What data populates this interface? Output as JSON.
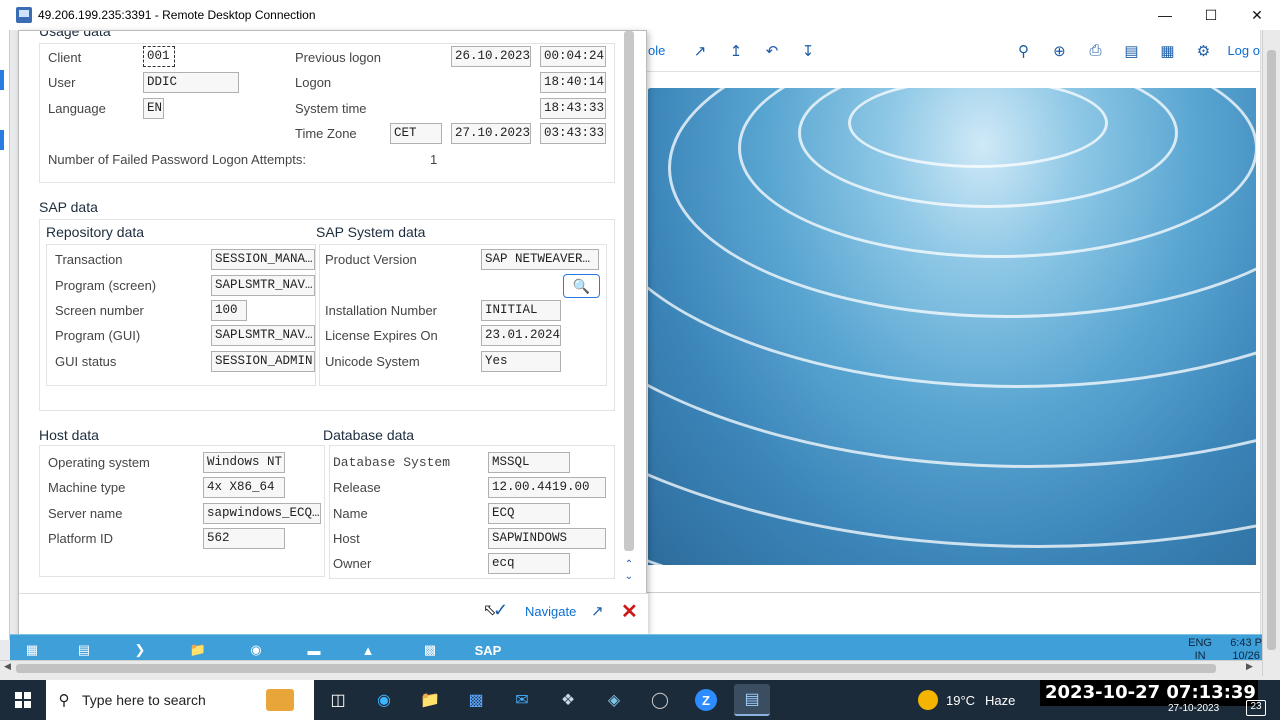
{
  "rdp": {
    "title": "49.206.199.235:3391 - Remote Desktop Connection",
    "minimize_icon": "minimize-icon",
    "maximize_icon": "maximize-icon",
    "close_icon": "close-icon"
  },
  "sap_toolbar": {
    "partial_text": "ole",
    "logoff_label": "Log o"
  },
  "dialog": {
    "usage": {
      "title": "Usage data",
      "client_label": "Client",
      "client_value": "001",
      "user_label": "User",
      "user_value": "DDIC",
      "language_label": "Language",
      "language_value": "EN",
      "prev_logon_label": "Previous logon",
      "prev_logon_date": "26.10.2023",
      "prev_logon_time": "00:04:24",
      "logon_label": "Logon",
      "logon_time": "18:40:14",
      "system_time_label": "System time",
      "system_time": "18:43:33",
      "tz_label": "Time Zone",
      "tz_value": "CET",
      "tz_date": "27.10.2023",
      "tz_time": "03:43:33",
      "failed_label": "Number of Failed Password Logon Attempts:",
      "failed_value": "1"
    },
    "sap": {
      "title": "SAP data",
      "repo_title": "Repository data",
      "sys_title": "SAP System data",
      "transaction_label": "Transaction",
      "transaction_value": "SESSION_MANA…",
      "program_screen_label": "Program (screen)",
      "program_screen_value": "SAPLSMTR_NAV…",
      "screen_number_label": "Screen number",
      "screen_number_value": "100",
      "program_gui_label": "Program (GUI)",
      "program_gui_value": "SAPLSMTR_NAV…",
      "gui_status_label": "GUI status",
      "gui_status_value": "SESSION_ADMIN",
      "product_version_label": "Product Version",
      "product_version_value": "SAP NETWEAVER…",
      "install_number_label": "Installation Number",
      "install_number_value": "INITIAL",
      "license_label": "License Expires On",
      "license_value": "23.01.2024",
      "unicode_label": "Unicode System",
      "unicode_value": "Yes"
    },
    "host": {
      "title": "Host data",
      "os_label": "Operating system",
      "os_value": "Windows NT",
      "machine_label": "Machine type",
      "machine_value": "4x X86_64",
      "server_label": "Server name",
      "server_value": "sapwindows_ECQ…",
      "platform_label": "Platform ID",
      "platform_value": "562"
    },
    "db": {
      "title": "Database data",
      "system_label": "Database System",
      "system_value": "MSSQL",
      "release_label": "Release",
      "release_value": "12.00.4419.00",
      "name_label": "Name",
      "name_value": "ECQ",
      "host_label": "Host",
      "host_value": "SAPWINDOWS",
      "owner_label": "Owner",
      "owner_value": "ecq"
    },
    "footer": {
      "navigate_label": "Navigate"
    }
  },
  "inner_taskbar": {
    "sap_label": "SAP",
    "lang": "ENG",
    "lang2": "IN",
    "time": "6:43 P",
    "date": "10/26"
  },
  "taskbar": {
    "search_placeholder": "Type here to search",
    "weather_temp": "19°C",
    "weather_desc": "Haze",
    "timestamp_overlay": "2023-10-27 07:13:39",
    "date": "27-10-2023",
    "notif_count": "23"
  }
}
